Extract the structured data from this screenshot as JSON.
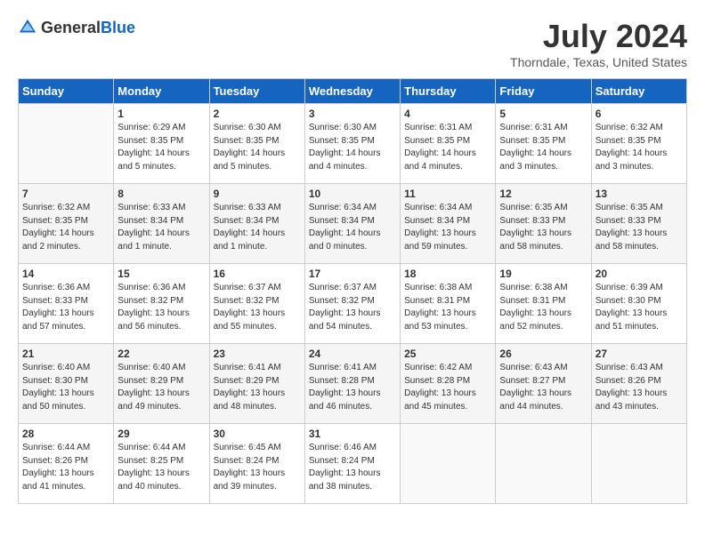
{
  "header": {
    "logo_general": "General",
    "logo_blue": "Blue",
    "month": "July 2024",
    "location": "Thorndale, Texas, United States"
  },
  "days_of_week": [
    "Sunday",
    "Monday",
    "Tuesday",
    "Wednesday",
    "Thursday",
    "Friday",
    "Saturday"
  ],
  "weeks": [
    [
      {
        "day": "",
        "info": ""
      },
      {
        "day": "1",
        "info": "Sunrise: 6:29 AM\nSunset: 8:35 PM\nDaylight: 14 hours\nand 5 minutes."
      },
      {
        "day": "2",
        "info": "Sunrise: 6:30 AM\nSunset: 8:35 PM\nDaylight: 14 hours\nand 5 minutes."
      },
      {
        "day": "3",
        "info": "Sunrise: 6:30 AM\nSunset: 8:35 PM\nDaylight: 14 hours\nand 4 minutes."
      },
      {
        "day": "4",
        "info": "Sunrise: 6:31 AM\nSunset: 8:35 PM\nDaylight: 14 hours\nand 4 minutes."
      },
      {
        "day": "5",
        "info": "Sunrise: 6:31 AM\nSunset: 8:35 PM\nDaylight: 14 hours\nand 3 minutes."
      },
      {
        "day": "6",
        "info": "Sunrise: 6:32 AM\nSunset: 8:35 PM\nDaylight: 14 hours\nand 3 minutes."
      }
    ],
    [
      {
        "day": "7",
        "info": "Sunrise: 6:32 AM\nSunset: 8:35 PM\nDaylight: 14 hours\nand 2 minutes."
      },
      {
        "day": "8",
        "info": "Sunrise: 6:33 AM\nSunset: 8:34 PM\nDaylight: 14 hours\nand 1 minute."
      },
      {
        "day": "9",
        "info": "Sunrise: 6:33 AM\nSunset: 8:34 PM\nDaylight: 14 hours\nand 1 minute."
      },
      {
        "day": "10",
        "info": "Sunrise: 6:34 AM\nSunset: 8:34 PM\nDaylight: 14 hours\nand 0 minutes."
      },
      {
        "day": "11",
        "info": "Sunrise: 6:34 AM\nSunset: 8:34 PM\nDaylight: 13 hours\nand 59 minutes."
      },
      {
        "day": "12",
        "info": "Sunrise: 6:35 AM\nSunset: 8:33 PM\nDaylight: 13 hours\nand 58 minutes."
      },
      {
        "day": "13",
        "info": "Sunrise: 6:35 AM\nSunset: 8:33 PM\nDaylight: 13 hours\nand 58 minutes."
      }
    ],
    [
      {
        "day": "14",
        "info": "Sunrise: 6:36 AM\nSunset: 8:33 PM\nDaylight: 13 hours\nand 57 minutes."
      },
      {
        "day": "15",
        "info": "Sunrise: 6:36 AM\nSunset: 8:32 PM\nDaylight: 13 hours\nand 56 minutes."
      },
      {
        "day": "16",
        "info": "Sunrise: 6:37 AM\nSunset: 8:32 PM\nDaylight: 13 hours\nand 55 minutes."
      },
      {
        "day": "17",
        "info": "Sunrise: 6:37 AM\nSunset: 8:32 PM\nDaylight: 13 hours\nand 54 minutes."
      },
      {
        "day": "18",
        "info": "Sunrise: 6:38 AM\nSunset: 8:31 PM\nDaylight: 13 hours\nand 53 minutes."
      },
      {
        "day": "19",
        "info": "Sunrise: 6:38 AM\nSunset: 8:31 PM\nDaylight: 13 hours\nand 52 minutes."
      },
      {
        "day": "20",
        "info": "Sunrise: 6:39 AM\nSunset: 8:30 PM\nDaylight: 13 hours\nand 51 minutes."
      }
    ],
    [
      {
        "day": "21",
        "info": "Sunrise: 6:40 AM\nSunset: 8:30 PM\nDaylight: 13 hours\nand 50 minutes."
      },
      {
        "day": "22",
        "info": "Sunrise: 6:40 AM\nSunset: 8:29 PM\nDaylight: 13 hours\nand 49 minutes."
      },
      {
        "day": "23",
        "info": "Sunrise: 6:41 AM\nSunset: 8:29 PM\nDaylight: 13 hours\nand 48 minutes."
      },
      {
        "day": "24",
        "info": "Sunrise: 6:41 AM\nSunset: 8:28 PM\nDaylight: 13 hours\nand 46 minutes."
      },
      {
        "day": "25",
        "info": "Sunrise: 6:42 AM\nSunset: 8:28 PM\nDaylight: 13 hours\nand 45 minutes."
      },
      {
        "day": "26",
        "info": "Sunrise: 6:43 AM\nSunset: 8:27 PM\nDaylight: 13 hours\nand 44 minutes."
      },
      {
        "day": "27",
        "info": "Sunrise: 6:43 AM\nSunset: 8:26 PM\nDaylight: 13 hours\nand 43 minutes."
      }
    ],
    [
      {
        "day": "28",
        "info": "Sunrise: 6:44 AM\nSunset: 8:26 PM\nDaylight: 13 hours\nand 41 minutes."
      },
      {
        "day": "29",
        "info": "Sunrise: 6:44 AM\nSunset: 8:25 PM\nDaylight: 13 hours\nand 40 minutes."
      },
      {
        "day": "30",
        "info": "Sunrise: 6:45 AM\nSunset: 8:24 PM\nDaylight: 13 hours\nand 39 minutes."
      },
      {
        "day": "31",
        "info": "Sunrise: 6:46 AM\nSunset: 8:24 PM\nDaylight: 13 hours\nand 38 minutes."
      },
      {
        "day": "",
        "info": ""
      },
      {
        "day": "",
        "info": ""
      },
      {
        "day": "",
        "info": ""
      }
    ]
  ]
}
